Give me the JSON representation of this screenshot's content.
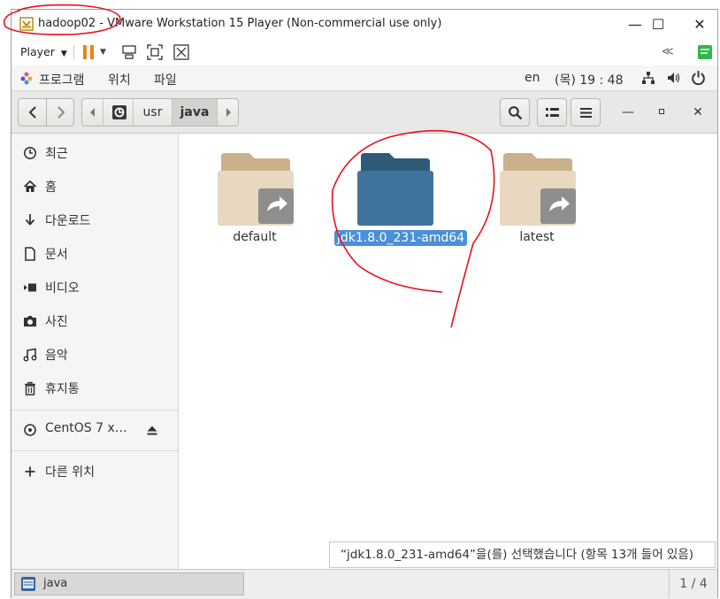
{
  "vmware": {
    "title": "hadoop02 - VMware Workstation 15 Player (Non-commercial use only)",
    "player_menu": "Player",
    "colors": {
      "pause": "#e8851a",
      "annotation": "#e8121b"
    }
  },
  "gnome_topbar": {
    "menu_programs": "프로그램",
    "menu_places": "위치",
    "menu_files": "파일",
    "language": "en",
    "clock": "(목) 19 : 48"
  },
  "pathbar": {
    "segments": [
      "usr",
      "java"
    ]
  },
  "sidebar": {
    "items": [
      {
        "label": "최근",
        "icon": "clock-icon"
      },
      {
        "label": "홈",
        "icon": "home-icon"
      },
      {
        "label": "다운로드",
        "icon": "download-icon"
      },
      {
        "label": "문서",
        "icon": "document-icon"
      },
      {
        "label": "비디오",
        "icon": "video-icon"
      },
      {
        "label": "사진",
        "icon": "camera-icon"
      },
      {
        "label": "음악",
        "icon": "music-icon"
      },
      {
        "label": "휴지통",
        "icon": "trash-icon"
      }
    ],
    "device": "CentOS 7 x…",
    "other_locations": "다른 위치"
  },
  "files": [
    {
      "name": "default",
      "type": "symlink-folder"
    },
    {
      "name": "jdk1.8.0_231-amd64",
      "type": "folder",
      "selected": true
    },
    {
      "name": "latest",
      "type": "symlink-folder"
    }
  ],
  "status": "“jdk1.8.0_231-amd64”을(를) 선택했습니다 (항목 13개 들어 있음)",
  "taskbar": {
    "task_label": "java",
    "page_counter": "1 / 4"
  }
}
